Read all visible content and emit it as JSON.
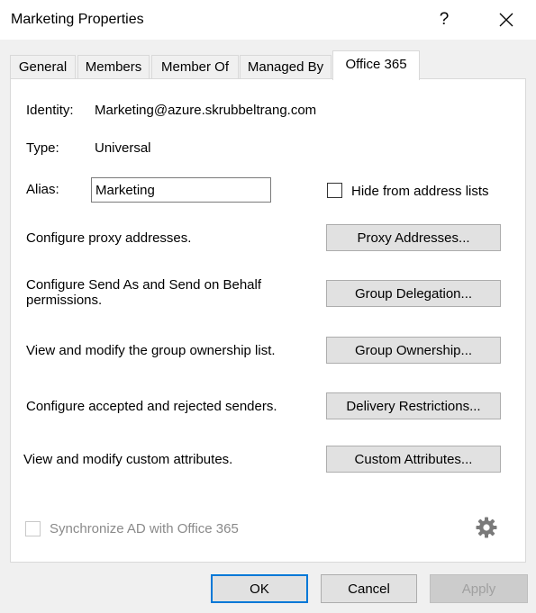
{
  "window": {
    "title": "Marketing Properties",
    "help_glyph": "?"
  },
  "tabs": [
    {
      "label": "General",
      "active": false
    },
    {
      "label": "Members",
      "active": false
    },
    {
      "label": "Member Of",
      "active": false
    },
    {
      "label": "Managed By",
      "active": false
    },
    {
      "label": "Office 365",
      "active": true
    }
  ],
  "fields": {
    "identity_label": "Identity:",
    "identity_value": "Marketing@azure.skrubbeltrang.com",
    "type_label": "Type:",
    "type_value": "Universal",
    "alias_label": "Alias:",
    "alias_value": "Marketing",
    "hide_label": "Hide from address lists",
    "hide_checked": false
  },
  "actions": [
    {
      "description": "Configure proxy addresses.",
      "button": "Proxy Addresses..."
    },
    {
      "description": "Configure Send As and Send on Behalf permissions.",
      "description_line1": "Configure Send As and Send on Behalf",
      "description_line2": "permissions.",
      "button": "Group Delegation..."
    },
    {
      "description": "View and modify the group ownership list.",
      "button": "Group Ownership..."
    },
    {
      "description": "Configure accepted and rejected senders.",
      "button": "Delivery Restrictions..."
    },
    {
      "description": "View and modify custom attributes.",
      "button": "Custom Attributes..."
    }
  ],
  "sync": {
    "label": "Synchronize AD with Office 365",
    "checked": false,
    "enabled": false
  },
  "footer": {
    "ok": "OK",
    "cancel": "Cancel",
    "apply": "Apply"
  },
  "colors": {
    "accent": "#0078d7",
    "disabled_text": "#8a8a8a"
  },
  "icons": [
    "help-icon",
    "close-icon",
    "gear-icon"
  ]
}
